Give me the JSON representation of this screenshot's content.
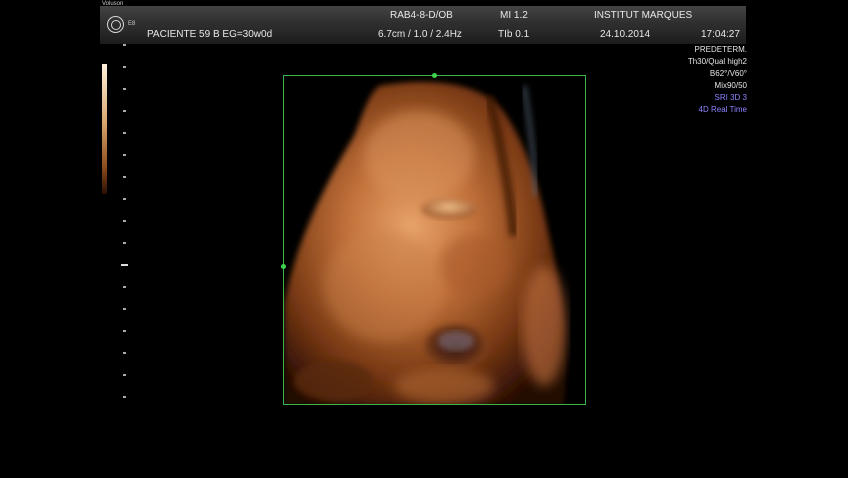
{
  "header": {
    "row1": {
      "corner_label": "Voluson",
      "probe": "RAB4-8-D/OB",
      "mi": "MI  1.2",
      "institution": "INSTITUT MARQUES"
    },
    "row2": {
      "patient": "PACIENTE 59 B  EG=30w0d",
      "depth_freq": "6.7cm / 1.0 / 2.4Hz",
      "tib": "TIb  0.1",
      "date": "24.10.2014",
      "time": "17:04:27"
    }
  },
  "right_panel": {
    "lines": [
      "PREDETERM.",
      "Th30/Qual high2",
      "B62°/V60°",
      "Mix90/50"
    ],
    "blue_lines": [
      "SRI 3D 3",
      "4D Real Time"
    ]
  },
  "colors": {
    "roi_border": "#3cb44a",
    "mode_text": "#8c84ff"
  },
  "icons": {
    "logo": "ge-logo-icon"
  }
}
